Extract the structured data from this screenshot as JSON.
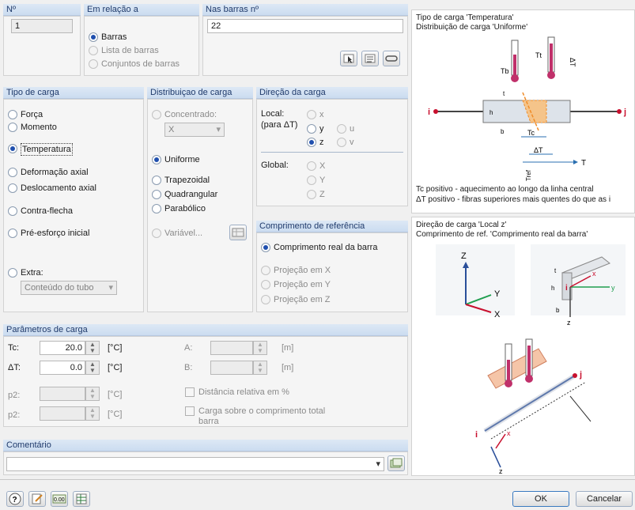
{
  "top": {
    "no_label": "Nº",
    "no_value": "1",
    "relation_label": "Em relação a",
    "relation_options": [
      "Barras",
      "Lista de barras",
      "Conjuntos de barras"
    ],
    "bars_label": "Nas barras nº",
    "bars_value": "22"
  },
  "load_type": {
    "title": "Tipo de carga",
    "options": [
      "Força",
      "Momento",
      "Temperatura",
      "Deformação axial",
      "Deslocamento axial",
      "Contra-flecha",
      "Pré-esforço inicial",
      "Extra:"
    ],
    "extra_value": "Conteúdo do tubo"
  },
  "distribution": {
    "title": "Distribuiçao de carga",
    "options": [
      "Concentrado:",
      "Uniforme",
      "Trapezoidal",
      "Quadrangular",
      "Parabólico",
      "Variável..."
    ],
    "concentrated_value": "X"
  },
  "direction": {
    "title": "Direção da carga",
    "local_label": "Local:",
    "local_sub": "(para ΔT)",
    "local_options": [
      "x",
      "y",
      "u",
      "z",
      "v"
    ],
    "global_label": "Global:",
    "global_options": [
      "X",
      "Y",
      "Z"
    ]
  },
  "reflength": {
    "title": "Comprimento de referência",
    "options": [
      "Comprimento real da barra",
      "Projeção em X",
      "Projeção em Y",
      "Projeção em Z"
    ]
  },
  "params": {
    "title": "Parâmetros de carga",
    "tc_label": "Tc:",
    "tc_value": "20.0",
    "dt_label": "ΔT:",
    "dt_value": "0.0",
    "p2a_label": "p2:",
    "p2b_label": "p2:",
    "unit_c": "[°C]",
    "a_label": "A:",
    "b_label": "B:",
    "unit_m": "[m]",
    "rel_dist": "Distância relativa em %",
    "total_len_1": "Carga sobre o comprimento total",
    "total_len_2": "barra"
  },
  "comment": {
    "title": "Comentário",
    "value": ""
  },
  "footer": {
    "ok": "OK",
    "cancel": "Cancelar"
  },
  "diagram1": {
    "line1": "Tipo de carga 'Temperatura'",
    "line2": "Distribuição de carga 'Uniforme'",
    "note1": "Tc positivo - aquecimento ao longo da linha central",
    "note2": "ΔT positivo - fibras superiores mais quentes do que as i",
    "labels": {
      "i": "i",
      "j": "j",
      "t": "t",
      "h": "h",
      "b": "b",
      "tc": "Tc",
      "dt": "ΔT",
      "tb": "Tb",
      "tt": "Tt",
      "T": "T",
      "tref": "Tref"
    }
  },
  "diagram2": {
    "line1": "Direção de carga 'Local z'",
    "line2": "Comprimento de ref. 'Comprimento real da barra'",
    "labels": {
      "Z": "Z",
      "Y": "Y",
      "X": "X",
      "t": "t",
      "h": "h",
      "i": "i",
      "b": "b",
      "y": "y",
      "z": "z",
      "x": "x",
      "j": "j"
    }
  },
  "colors": {
    "accent": "#1f4fae",
    "header": "#cbdcf0",
    "orange": "#f08c28"
  }
}
